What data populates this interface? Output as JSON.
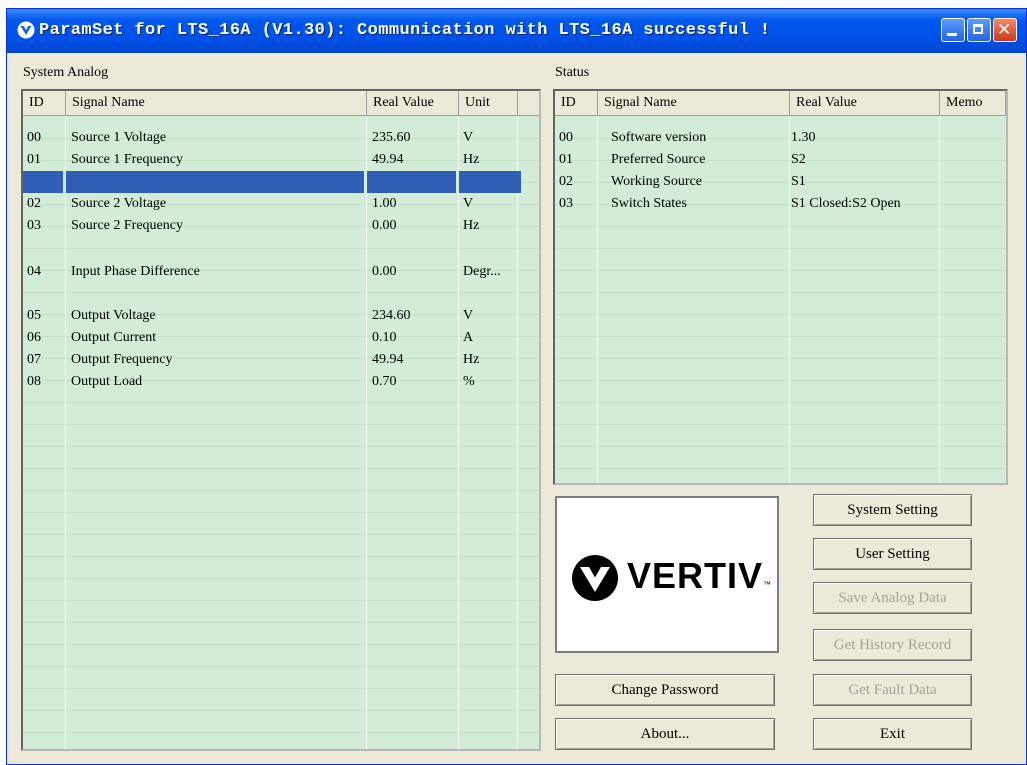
{
  "window": {
    "title": "ParamSet for LTS_16A (V1.30): Communication with LTS_16A successful !"
  },
  "analog": {
    "label": "System Analog",
    "headers": [
      "ID",
      "Signal Name",
      "Real Value",
      "Unit"
    ],
    "rows": [
      {
        "id": "00",
        "name": "Source 1 Voltage",
        "value": "235.60",
        "unit": "V"
      },
      {
        "id": "01",
        "name": "Source 1 Frequency",
        "value": "49.94",
        "unit": "Hz"
      },
      {
        "id": "02",
        "name": "Source 2 Voltage",
        "value": "1.00",
        "unit": "V"
      },
      {
        "id": "03",
        "name": "Source 2 Frequency",
        "value": "0.00",
        "unit": "Hz"
      },
      {
        "id": "04",
        "name": "Input Phase Difference",
        "value": "0.00",
        "unit": "Degr..."
      },
      {
        "id": "05",
        "name": "Output Voltage",
        "value": "234.60",
        "unit": "V"
      },
      {
        "id": "06",
        "name": "Output Current",
        "value": "0.10",
        "unit": "A"
      },
      {
        "id": "07",
        "name": "Output Frequency",
        "value": "49.94",
        "unit": "Hz"
      },
      {
        "id": "08",
        "name": "Output Load",
        "value": "0.70",
        "unit": "%"
      }
    ]
  },
  "status": {
    "label": "Status",
    "headers": [
      "ID",
      "Signal Name",
      "Real Value",
      "Memo"
    ],
    "rows": [
      {
        "id": "00",
        "name": "Software version",
        "value": "1.30",
        "memo": ""
      },
      {
        "id": "01",
        "name": "Preferred Source",
        "value": "S2",
        "memo": ""
      },
      {
        "id": "02",
        "name": "Working Source",
        "value": "S1",
        "memo": ""
      },
      {
        "id": "03",
        "name": "Switch States",
        "value": "S1 Closed:S2 Open",
        "memo": ""
      }
    ]
  },
  "logo": {
    "text": "VERTIV",
    "tm": "™",
    "color": "#000000"
  },
  "buttons": {
    "system_setting": "System Setting",
    "user_setting": "User Setting",
    "save_analog": "Save Analog Data",
    "history": "Get History Record",
    "change_password": "Change Password",
    "fault": "Get Fault Data",
    "about": "About...",
    "exit": "Exit"
  },
  "colors": {
    "titlebar": "#0054e3",
    "list_bg": "#d3ecd8",
    "selection": "#2f5fb5",
    "face": "#ece9d8",
    "disabled_text": "#a4a39c"
  }
}
